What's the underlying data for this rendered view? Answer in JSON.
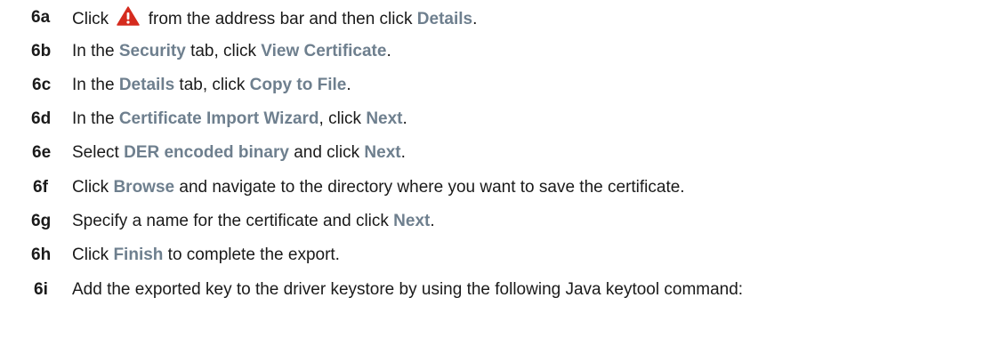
{
  "steps": [
    {
      "num": "6a",
      "parts": [
        {
          "t": "Click "
        },
        {
          "icon": "warning-icon",
          "color": "#d52b1e"
        },
        {
          "t": " from the address bar and then click "
        },
        {
          "t": "Details",
          "ui": true
        },
        {
          "t": "."
        }
      ]
    },
    {
      "num": "6b",
      "parts": [
        {
          "t": "In the "
        },
        {
          "t": "Security",
          "ui": true
        },
        {
          "t": " tab, click "
        },
        {
          "t": "View Certificate",
          "ui": true
        },
        {
          "t": "."
        }
      ]
    },
    {
      "num": "6c",
      "parts": [
        {
          "t": "In the "
        },
        {
          "t": "Details",
          "ui": true
        },
        {
          "t": " tab, click "
        },
        {
          "t": "Copy to File",
          "ui": true
        },
        {
          "t": "."
        }
      ]
    },
    {
      "num": "6d",
      "parts": [
        {
          "t": "In the "
        },
        {
          "t": "Certificate Import Wizard",
          "ui": true
        },
        {
          "t": ", click "
        },
        {
          "t": "Next",
          "ui": true
        },
        {
          "t": "."
        }
      ]
    },
    {
      "num": "6e",
      "parts": [
        {
          "t": "Select "
        },
        {
          "t": "DER encoded binary",
          "ui": true
        },
        {
          "t": " and click "
        },
        {
          "t": "Next",
          "ui": true
        },
        {
          "t": "."
        }
      ]
    },
    {
      "num": "6f",
      "parts": [
        {
          "t": "Click "
        },
        {
          "t": "Browse",
          "ui": true
        },
        {
          "t": " and navigate to the directory where you want to save the certificate."
        }
      ]
    },
    {
      "num": "6g",
      "parts": [
        {
          "t": "Specify a name for the certificate and click "
        },
        {
          "t": "Next",
          "ui": true
        },
        {
          "t": "."
        }
      ]
    },
    {
      "num": "6h",
      "parts": [
        {
          "t": "Click "
        },
        {
          "t": "Finish",
          "ui": true
        },
        {
          "t": " to complete the export."
        }
      ]
    },
    {
      "num": "6i",
      "parts": [
        {
          "t": "Add the exported key to the driver keystore by using the following Java keytool command:"
        }
      ]
    }
  ],
  "colors": {
    "text": "#1a1a1a",
    "ui_term": "#6e7f8e",
    "warning_icon": "#d52b1e"
  }
}
